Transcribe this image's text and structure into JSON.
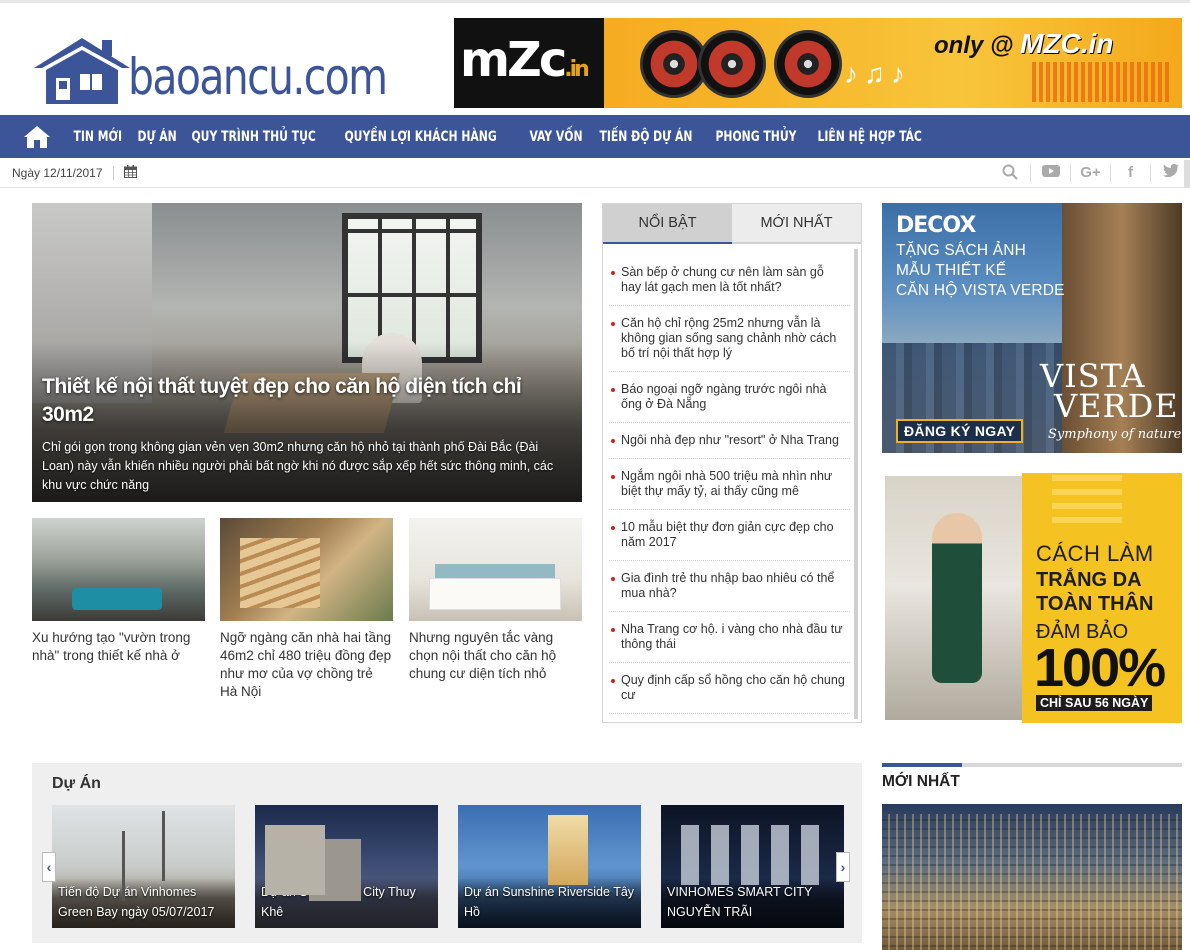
{
  "header": {
    "logo_text": "baoancu.com",
    "banner": {
      "brand": "mZc",
      "brand_suffix": ".in",
      "tagline_prefix": "only @",
      "tagline_brand": "MZC.in"
    }
  },
  "nav": {
    "home_icon": "home-icon",
    "items": [
      {
        "label": "TIN MỚI"
      },
      {
        "label": "DỰ ÁN"
      },
      {
        "label": "QUY TRÌNH THỦ TỤC"
      },
      {
        "label": "QUYỀN LỢI KHÁCH HÀNG"
      },
      {
        "label": "VAY VỐN"
      },
      {
        "label": "TIẾN ĐỘ DỰ ÁN"
      },
      {
        "label": "PHONG THỦY"
      },
      {
        "label": "LIÊN HỆ HỢP TÁC"
      }
    ]
  },
  "datebar": {
    "date": "Ngày 12/11/2017",
    "calendar_icon": "calendar-icon",
    "social": [
      "search-icon",
      "youtube-icon",
      "google-plus-icon",
      "facebook-icon",
      "twitter-icon"
    ]
  },
  "hero": {
    "title": "Thiết kế nội thất tuyệt đẹp cho căn hộ diện tích chỉ 30m2",
    "description": "Chỉ gói gọn trong không gian vẻn vẹn 30m2 nhưng căn hộ nhỏ tại thành phố Đài Bắc (Đài Loan) này vẫn khiến nhiều người phải bất ngờ khi nó được sắp xếp hết sức thông minh, các khu vực chức năng"
  },
  "cards": [
    {
      "caption": "Xu hướng tạo \"vườn trong nhà\" trong thiết kế nhà ở"
    },
    {
      "caption": "Ngỡ ngàng căn nhà hai tầng 46m2 chỉ 480 triệu đồng đẹp như mơ của vợ chồng trẻ Hà Nội"
    },
    {
      "caption": "Nhưng nguyên tắc vàng chọn nội thất cho căn hộ chung cư diện tích nhỏ"
    }
  ],
  "tabs": {
    "active": "NỔI BẬT",
    "inactive": "MỚI NHẤT",
    "items": [
      "Sàn bếp ở chung cư nên làm sàn gỗ hay lát gạch men là tốt nhất?",
      "Căn hộ chỉ rộng 25m2 nhưng vẫn là không gian sống sang chảnh nhờ cách bố trí nội thất hợp lý",
      "Báo ngoại ngỡ ngàng trước ngôi nhà ống ở Đà Nẵng",
      "Ngôi nhà đẹp như \"resort\" ở Nha Trang",
      "Ngắm ngôi nhà 500 triệu mà nhìn như biệt thự mấy tỷ, ai thấy cũng mê",
      "10 mẫu biệt thự đơn giản cực đẹp cho năm 2017",
      "Gia đình trẻ thu nhập bao nhiêu có thể mua nhà?",
      "Nha Trang cơ hộ. i vàng cho nhà đầu tư thông thái",
      "Quy định cấp sổ hồng cho căn hộ chung cư"
    ]
  },
  "ad1": {
    "brand": "DECOX",
    "line1": "TẶNG SÁCH ẢNH",
    "line2": "MẪU THIẾT KẾ",
    "line3": "CĂN HỘ VISTA VERDE",
    "vista1": "VISTA",
    "vista2": "VERDE",
    "slogan": "Symphony of nature",
    "button": "ĐĂNG KÝ NGAY"
  },
  "ad2": {
    "l1": "CÁCH LÀM",
    "l2": "TRẮNG DA",
    "l3": "TOÀN THÂN",
    "l4": "ĐẢM BẢO",
    "l5": "100%",
    "l6": "CHỈ SAU 56 NGÀY"
  },
  "duan": {
    "heading": "Dự Án",
    "prev": "‹",
    "next": "›",
    "projects": [
      {
        "caption": "Tiến độ Dự án Vinhomes Green Bay ngày 05/07/2017"
      },
      {
        "caption": "Dự án Sun Grand City Thuy Khê"
      },
      {
        "caption": "Dự án Sunshine Riverside Tây Hồ"
      },
      {
        "caption": "VINHOMES SMART CITY NGUYỄN TRÃI"
      }
    ]
  },
  "moinhat": {
    "heading": "MỚI NHẤT"
  }
}
